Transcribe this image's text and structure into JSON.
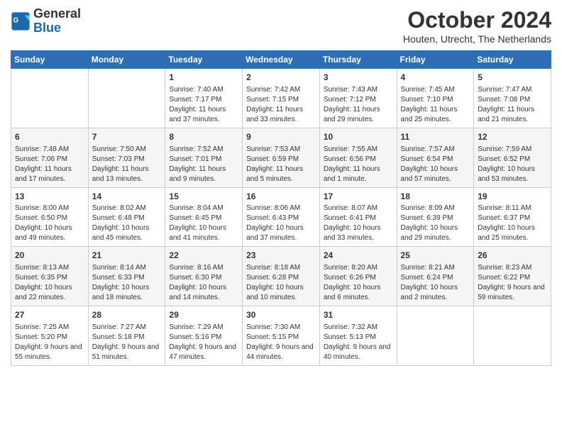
{
  "header": {
    "logo_line1": "General",
    "logo_line2": "Blue",
    "month": "October 2024",
    "location": "Houten, Utrecht, The Netherlands"
  },
  "days_of_week": [
    "Sunday",
    "Monday",
    "Tuesday",
    "Wednesday",
    "Thursday",
    "Friday",
    "Saturday"
  ],
  "weeks": [
    [
      {
        "day": "",
        "info": ""
      },
      {
        "day": "",
        "info": ""
      },
      {
        "day": "1",
        "info": "Sunrise: 7:40 AM\nSunset: 7:17 PM\nDaylight: 11 hours and 37 minutes."
      },
      {
        "day": "2",
        "info": "Sunrise: 7:42 AM\nSunset: 7:15 PM\nDaylight: 11 hours and 33 minutes."
      },
      {
        "day": "3",
        "info": "Sunrise: 7:43 AM\nSunset: 7:12 PM\nDaylight: 11 hours and 29 minutes."
      },
      {
        "day": "4",
        "info": "Sunrise: 7:45 AM\nSunset: 7:10 PM\nDaylight: 11 hours and 25 minutes."
      },
      {
        "day": "5",
        "info": "Sunrise: 7:47 AM\nSunset: 7:08 PM\nDaylight: 11 hours and 21 minutes."
      }
    ],
    [
      {
        "day": "6",
        "info": "Sunrise: 7:48 AM\nSunset: 7:06 PM\nDaylight: 11 hours and 17 minutes."
      },
      {
        "day": "7",
        "info": "Sunrise: 7:50 AM\nSunset: 7:03 PM\nDaylight: 11 hours and 13 minutes."
      },
      {
        "day": "8",
        "info": "Sunrise: 7:52 AM\nSunset: 7:01 PM\nDaylight: 11 hours and 9 minutes."
      },
      {
        "day": "9",
        "info": "Sunrise: 7:53 AM\nSunset: 6:59 PM\nDaylight: 11 hours and 5 minutes."
      },
      {
        "day": "10",
        "info": "Sunrise: 7:55 AM\nSunset: 6:56 PM\nDaylight: 11 hours and 1 minute."
      },
      {
        "day": "11",
        "info": "Sunrise: 7:57 AM\nSunset: 6:54 PM\nDaylight: 10 hours and 57 minutes."
      },
      {
        "day": "12",
        "info": "Sunrise: 7:59 AM\nSunset: 6:52 PM\nDaylight: 10 hours and 53 minutes."
      }
    ],
    [
      {
        "day": "13",
        "info": "Sunrise: 8:00 AM\nSunset: 6:50 PM\nDaylight: 10 hours and 49 minutes."
      },
      {
        "day": "14",
        "info": "Sunrise: 8:02 AM\nSunset: 6:48 PM\nDaylight: 10 hours and 45 minutes."
      },
      {
        "day": "15",
        "info": "Sunrise: 8:04 AM\nSunset: 6:45 PM\nDaylight: 10 hours and 41 minutes."
      },
      {
        "day": "16",
        "info": "Sunrise: 8:06 AM\nSunset: 6:43 PM\nDaylight: 10 hours and 37 minutes."
      },
      {
        "day": "17",
        "info": "Sunrise: 8:07 AM\nSunset: 6:41 PM\nDaylight: 10 hours and 33 minutes."
      },
      {
        "day": "18",
        "info": "Sunrise: 8:09 AM\nSunset: 6:39 PM\nDaylight: 10 hours and 29 minutes."
      },
      {
        "day": "19",
        "info": "Sunrise: 8:11 AM\nSunset: 6:37 PM\nDaylight: 10 hours and 25 minutes."
      }
    ],
    [
      {
        "day": "20",
        "info": "Sunrise: 8:13 AM\nSunset: 6:35 PM\nDaylight: 10 hours and 22 minutes."
      },
      {
        "day": "21",
        "info": "Sunrise: 8:14 AM\nSunset: 6:33 PM\nDaylight: 10 hours and 18 minutes."
      },
      {
        "day": "22",
        "info": "Sunrise: 8:16 AM\nSunset: 6:30 PM\nDaylight: 10 hours and 14 minutes."
      },
      {
        "day": "23",
        "info": "Sunrise: 8:18 AM\nSunset: 6:28 PM\nDaylight: 10 hours and 10 minutes."
      },
      {
        "day": "24",
        "info": "Sunrise: 8:20 AM\nSunset: 6:26 PM\nDaylight: 10 hours and 6 minutes."
      },
      {
        "day": "25",
        "info": "Sunrise: 8:21 AM\nSunset: 6:24 PM\nDaylight: 10 hours and 2 minutes."
      },
      {
        "day": "26",
        "info": "Sunrise: 8:23 AM\nSunset: 6:22 PM\nDaylight: 9 hours and 59 minutes."
      }
    ],
    [
      {
        "day": "27",
        "info": "Sunrise: 7:25 AM\nSunset: 5:20 PM\nDaylight: 9 hours and 55 minutes."
      },
      {
        "day": "28",
        "info": "Sunrise: 7:27 AM\nSunset: 5:18 PM\nDaylight: 9 hours and 51 minutes."
      },
      {
        "day": "29",
        "info": "Sunrise: 7:29 AM\nSunset: 5:16 PM\nDaylight: 9 hours and 47 minutes."
      },
      {
        "day": "30",
        "info": "Sunrise: 7:30 AM\nSunset: 5:15 PM\nDaylight: 9 hours and 44 minutes."
      },
      {
        "day": "31",
        "info": "Sunrise: 7:32 AM\nSunset: 5:13 PM\nDaylight: 9 hours and 40 minutes."
      },
      {
        "day": "",
        "info": ""
      },
      {
        "day": "",
        "info": ""
      }
    ]
  ]
}
